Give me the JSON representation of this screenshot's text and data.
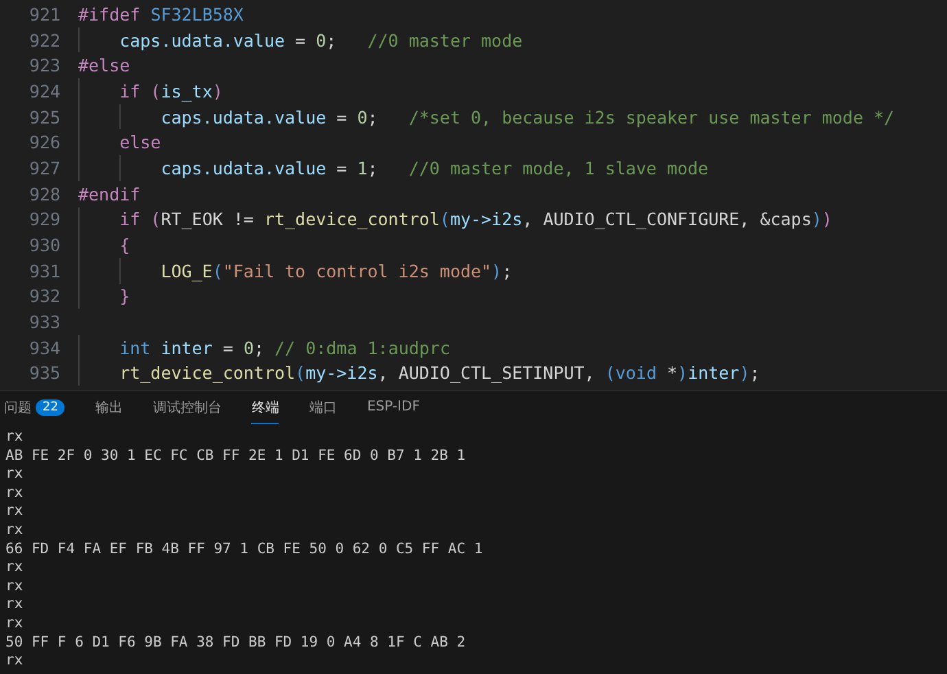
{
  "editor": {
    "lines": [
      {
        "number": "921",
        "tokens": [
          {
            "kind": "keyword",
            "text": "#ifdef "
          },
          {
            "kind": "macro",
            "text": "SF32LB58X"
          }
        ]
      },
      {
        "number": "922",
        "tokens": [
          {
            "kind": "variable",
            "text": "    caps.udata.value"
          },
          {
            "kind": "plain",
            "text": " = "
          },
          {
            "kind": "number",
            "text": "0"
          },
          {
            "kind": "plain",
            "text": ";   "
          },
          {
            "kind": "comment",
            "text": "//0 master mode"
          }
        ]
      },
      {
        "number": "923",
        "tokens": [
          {
            "kind": "keyword",
            "text": "#else"
          }
        ]
      },
      {
        "number": "924",
        "tokens": [
          {
            "kind": "keyword",
            "text": "    if ("
          },
          {
            "kind": "variable",
            "text": "is_tx"
          },
          {
            "kind": "keyword",
            "text": ")"
          }
        ]
      },
      {
        "number": "925",
        "tokens": [
          {
            "kind": "variable",
            "text": "        caps.udata.value"
          },
          {
            "kind": "plain",
            "text": " = "
          },
          {
            "kind": "number",
            "text": "0"
          },
          {
            "kind": "plain",
            "text": ";   "
          },
          {
            "kind": "comment",
            "text": "/*set 0, because i2s speaker use master mode */"
          }
        ]
      },
      {
        "number": "926",
        "tokens": [
          {
            "kind": "keyword",
            "text": "    else"
          }
        ]
      },
      {
        "number": "927",
        "tokens": [
          {
            "kind": "variable",
            "text": "        caps.udata.value"
          },
          {
            "kind": "plain",
            "text": " = "
          },
          {
            "kind": "number",
            "text": "1"
          },
          {
            "kind": "plain",
            "text": ";   "
          },
          {
            "kind": "comment",
            "text": "//0 master mode, 1 slave mode"
          }
        ]
      },
      {
        "number": "928",
        "tokens": [
          {
            "kind": "keyword",
            "text": "#endif"
          }
        ]
      },
      {
        "number": "929",
        "tokens": [
          {
            "kind": "keyword",
            "text": "    if ("
          },
          {
            "kind": "plain",
            "text": "RT_EOK != "
          },
          {
            "kind": "function",
            "text": "rt_device_control"
          },
          {
            "kind": "macro",
            "text": "("
          },
          {
            "kind": "variable",
            "text": "my->i2s"
          },
          {
            "kind": "plain",
            "text": ", AUDIO_CTL_CONFIGURE, &caps"
          },
          {
            "kind": "macro",
            "text": ")"
          },
          {
            "kind": "keyword",
            "text": ")"
          }
        ]
      },
      {
        "number": "930",
        "tokens": [
          {
            "kind": "keyword",
            "text": "    {"
          }
        ]
      },
      {
        "number": "931",
        "tokens": [
          {
            "kind": "function",
            "text": "        LOG_E"
          },
          {
            "kind": "macro",
            "text": "("
          },
          {
            "kind": "string",
            "text": "\"Fail to control i2s mode\""
          },
          {
            "kind": "macro",
            "text": ")"
          },
          {
            "kind": "plain",
            "text": ";"
          }
        ]
      },
      {
        "number": "932",
        "tokens": [
          {
            "kind": "keyword",
            "text": "    }"
          }
        ]
      },
      {
        "number": "933"
      },
      {
        "number": "934",
        "tokens": [
          {
            "kind": "type",
            "text": "    int "
          },
          {
            "kind": "variable",
            "text": "inter"
          },
          {
            "kind": "plain",
            "text": " = "
          },
          {
            "kind": "number",
            "text": "0"
          },
          {
            "kind": "plain",
            "text": "; "
          },
          {
            "kind": "comment",
            "text": "// 0:dma 1:audprc"
          }
        ]
      },
      {
        "number": "935",
        "tokens": [
          {
            "kind": "function",
            "text": "    rt_device_control"
          },
          {
            "kind": "macro",
            "text": "("
          },
          {
            "kind": "variable",
            "text": "my->i2s"
          },
          {
            "kind": "plain",
            "text": ", AUDIO_CTL_SETINPUT, "
          },
          {
            "kind": "macro",
            "text": "("
          },
          {
            "kind": "type",
            "text": "void"
          },
          {
            "kind": "plain",
            "text": " *"
          },
          {
            "kind": "macro",
            "text": ")"
          },
          {
            "kind": "variable",
            "text": "inter"
          },
          {
            "kind": "macro",
            "text": ")"
          },
          {
            "kind": "plain",
            "text": ";"
          }
        ]
      }
    ]
  },
  "panel": {
    "tabs": [
      {
        "label": "问题",
        "badge": "22",
        "selected": false
      },
      {
        "label": "输出",
        "selected": false
      },
      {
        "label": "调试控制台",
        "selected": false
      },
      {
        "label": "终端",
        "selected": true
      },
      {
        "label": "端口",
        "selected": false
      },
      {
        "label": "ESP-IDF",
        "selected": false
      }
    ],
    "terminal_lines": [
      "rx",
      "AB FE 2F 0 30 1 EC FC CB FF 2E 1 D1 FE 6D 0 B7 1 2B 1",
      "rx",
      "rx",
      "rx",
      "rx",
      "66 FD F4 FA EF FB 4B FF 97 1 CB FE 50 0 62 0 C5 FF AC 1",
      "rx",
      "rx",
      "rx",
      "rx",
      "50 FF F 6 D1 F6 9B FA 38 FD BB FD 19 0 A4 8 1F C AB 2",
      "rx"
    ]
  }
}
